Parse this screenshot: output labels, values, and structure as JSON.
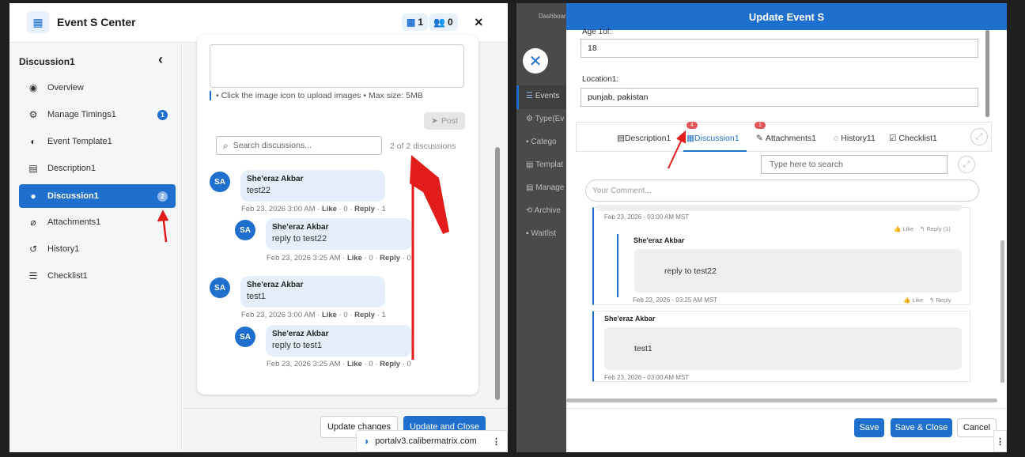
{
  "left": {
    "title": "Event S Center",
    "stat1": "1",
    "stat2": "0",
    "close": "×",
    "sidebar": {
      "header": "Discussion1",
      "collapse": "‹",
      "items": [
        {
          "label": "Overview",
          "icon": "globe-icon",
          "glyph": "◉"
        },
        {
          "label": "Manage Timings1",
          "icon": "gear-icon",
          "glyph": "⚙",
          "badge": "1"
        },
        {
          "label": "Event Template1",
          "icon": "palette-icon",
          "glyph": "◐"
        },
        {
          "label": "Description1",
          "icon": "file-icon",
          "glyph": "▤"
        },
        {
          "label": "Discussion1",
          "icon": "chat-icon",
          "glyph": "●",
          "badge": "2"
        },
        {
          "label": "Attachments1",
          "icon": "paperclip-icon",
          "glyph": "⌀"
        },
        {
          "label": "History1",
          "icon": "history-icon",
          "glyph": "↺"
        },
        {
          "label": "Checklist1",
          "icon": "checklist-icon",
          "glyph": "☰"
        }
      ]
    },
    "upload_hint": "• Click the image icon to upload images • Max size: 5MB",
    "post_label": "Post",
    "search_placeholder": "Search discussions...",
    "count": "2 of 2 discussions",
    "comments": [
      {
        "initials": "SA",
        "author": "She'eraz Akbar",
        "text": "test22",
        "date": "Feb 23, 2026 3:00 AM",
        "like": "Like",
        "likes": "0",
        "reply": "Reply",
        "replies": "1",
        "reply_item": {
          "initials": "SA",
          "author": "She'eraz Akbar",
          "text": "reply to test22",
          "date": "Feb 23, 2026 3:25 AM",
          "like": "Like",
          "likes": "0",
          "reply": "Reply",
          "replies": "0"
        }
      },
      {
        "initials": "SA",
        "author": "She'eraz Akbar",
        "text": "test1",
        "date": "Feb 23, 2026 3:00 AM",
        "like": "Like",
        "likes": "0",
        "reply": "Reply",
        "replies": "1",
        "reply_item": {
          "initials": "SA",
          "author": "She'eraz Akbar",
          "text": "reply to test1",
          "date": "Feb 23, 2026 3:25 AM",
          "like": "Like",
          "likes": "0",
          "reply": "Reply",
          "replies": "0"
        }
      }
    ],
    "update_changes": "Update changes",
    "update_close": "Update and Close",
    "url": "portalv3.calibermatrix.com"
  },
  "right": {
    "title": "Update Event S",
    "bg_nav": [
      "Dashboard",
      "Events",
      "Type(Ev",
      "Catego",
      "Templat",
      "Manage",
      "Archive",
      "Waitlist"
    ],
    "age_label": "Age 1of:",
    "age_value": "18",
    "location_label": "Location1:",
    "location_value": "punjab, pakistan",
    "tabs": [
      {
        "label": "Description1",
        "glyph": "▤"
      },
      {
        "label": "Discussion1",
        "glyph": "▦",
        "badge": "4"
      },
      {
        "label": "Attachments1",
        "glyph": "✎",
        "badge": "1"
      },
      {
        "label": "History11",
        "glyph": "◌"
      },
      {
        "label": "Checklist1",
        "glyph": "☑"
      }
    ],
    "search_placeholder": "Type here to search",
    "comment_placeholder": "Your Comment...",
    "thread": {
      "top_date": "Feb 23, 2026 - 03:00 AM MST",
      "like": "Like",
      "reply": "Reply (1)",
      "reply_author": "She'eraz Akbar",
      "reply_text": "reply to test22",
      "reply_date": "Feb 23, 2026 - 03:25 AM MST",
      "reply_like": "Like",
      "reply_reply": "Reply"
    },
    "thread2": {
      "author": "She'eraz Akbar",
      "text": "test1",
      "date": "Feb 23, 2026 - 03:00 AM MST"
    },
    "save": "Save",
    "save_close": "Save & Close",
    "cancel": "Cancel"
  },
  "colors": {
    "primary": "#1f6fce",
    "arrow": "#e21b1b",
    "badge_red": "#e05656"
  }
}
